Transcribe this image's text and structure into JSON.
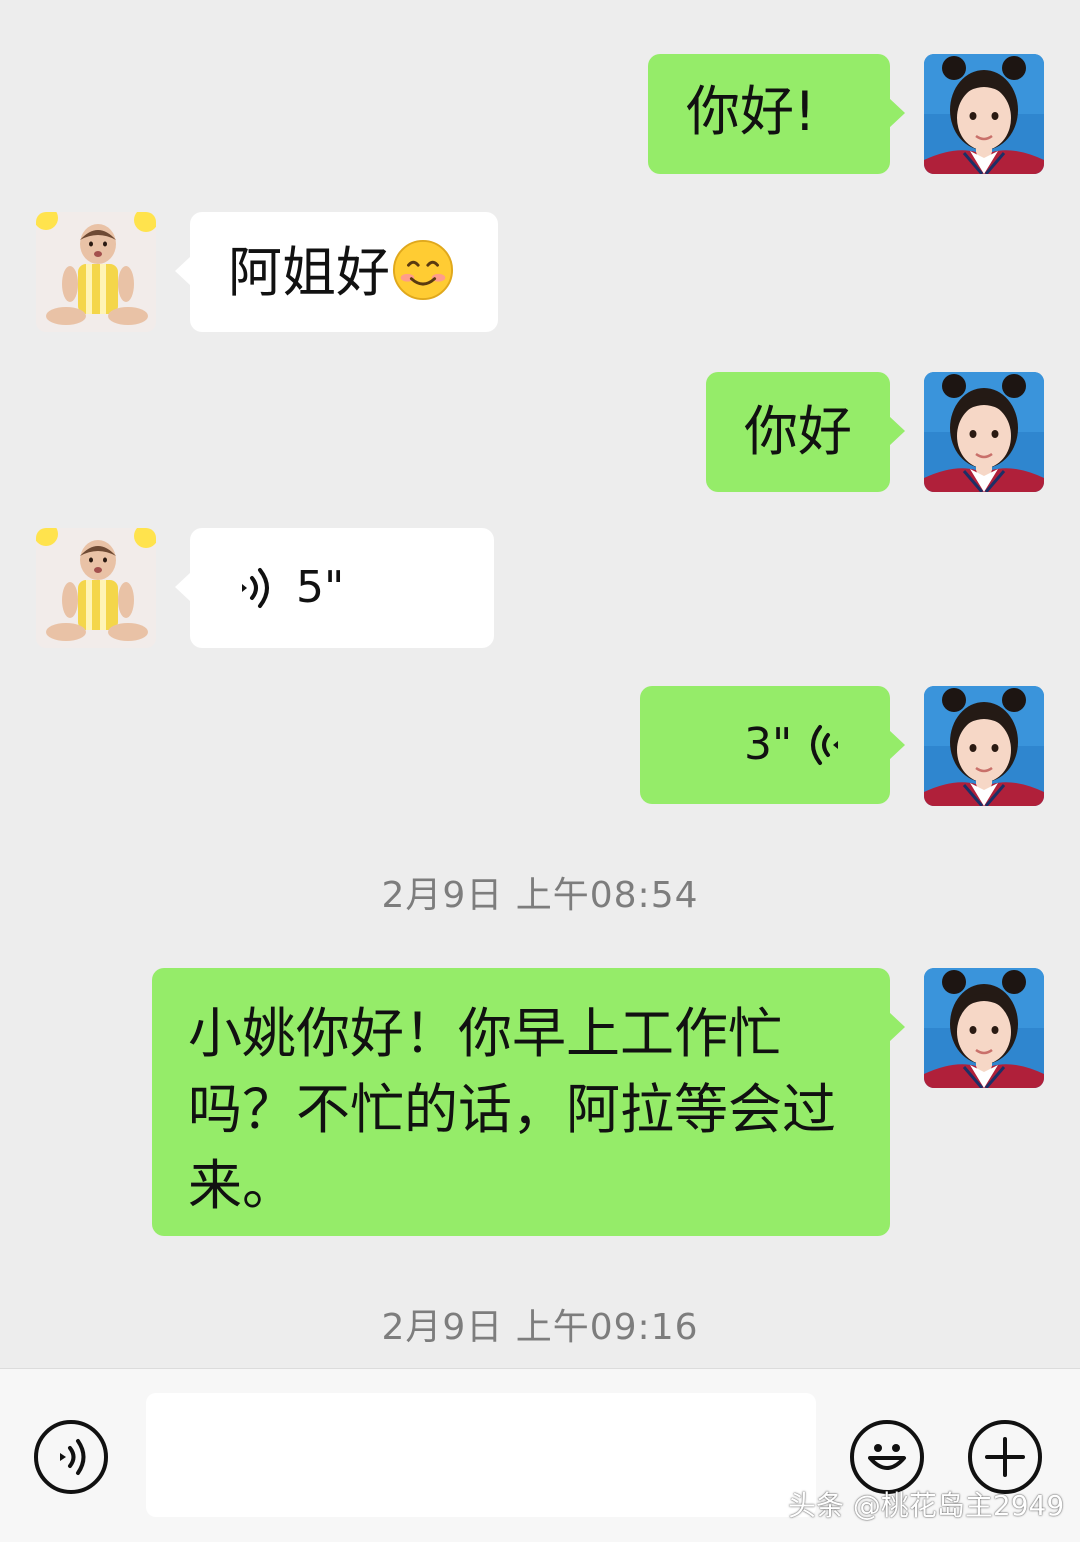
{
  "colors": {
    "background": "#ededed",
    "sent_bubble": "#95ec69",
    "received_bubble": "#ffffff",
    "timestamp_text": "#7d7d7d",
    "input_bar": "#f7f7f7"
  },
  "messages": [
    {
      "side": "right",
      "type": "text",
      "text": "你好!"
    },
    {
      "side": "left",
      "type": "text",
      "text": "阿姐好",
      "emoji": "smiling-face-emoji"
    },
    {
      "side": "right",
      "type": "text",
      "text": "你好"
    },
    {
      "side": "left",
      "type": "voice",
      "duration": "5\""
    },
    {
      "side": "right",
      "type": "voice",
      "duration": "3\""
    },
    {
      "side": "right",
      "type": "text",
      "lines": [
        "小姚你好！你早上工作忙",
        "吗？不忙的话，阿拉等会过",
        "来。"
      ]
    }
  ],
  "timestamps": [
    "2月9日 上午08:54",
    "2月9日 上午09:16"
  ],
  "input_bar": {
    "voice_icon": "voice-mode-icon",
    "emoji_icon": "emoji-icon",
    "plus_icon": "plus-icon",
    "placeholder": ""
  },
  "watermark": "头条 @桃花岛主2949"
}
